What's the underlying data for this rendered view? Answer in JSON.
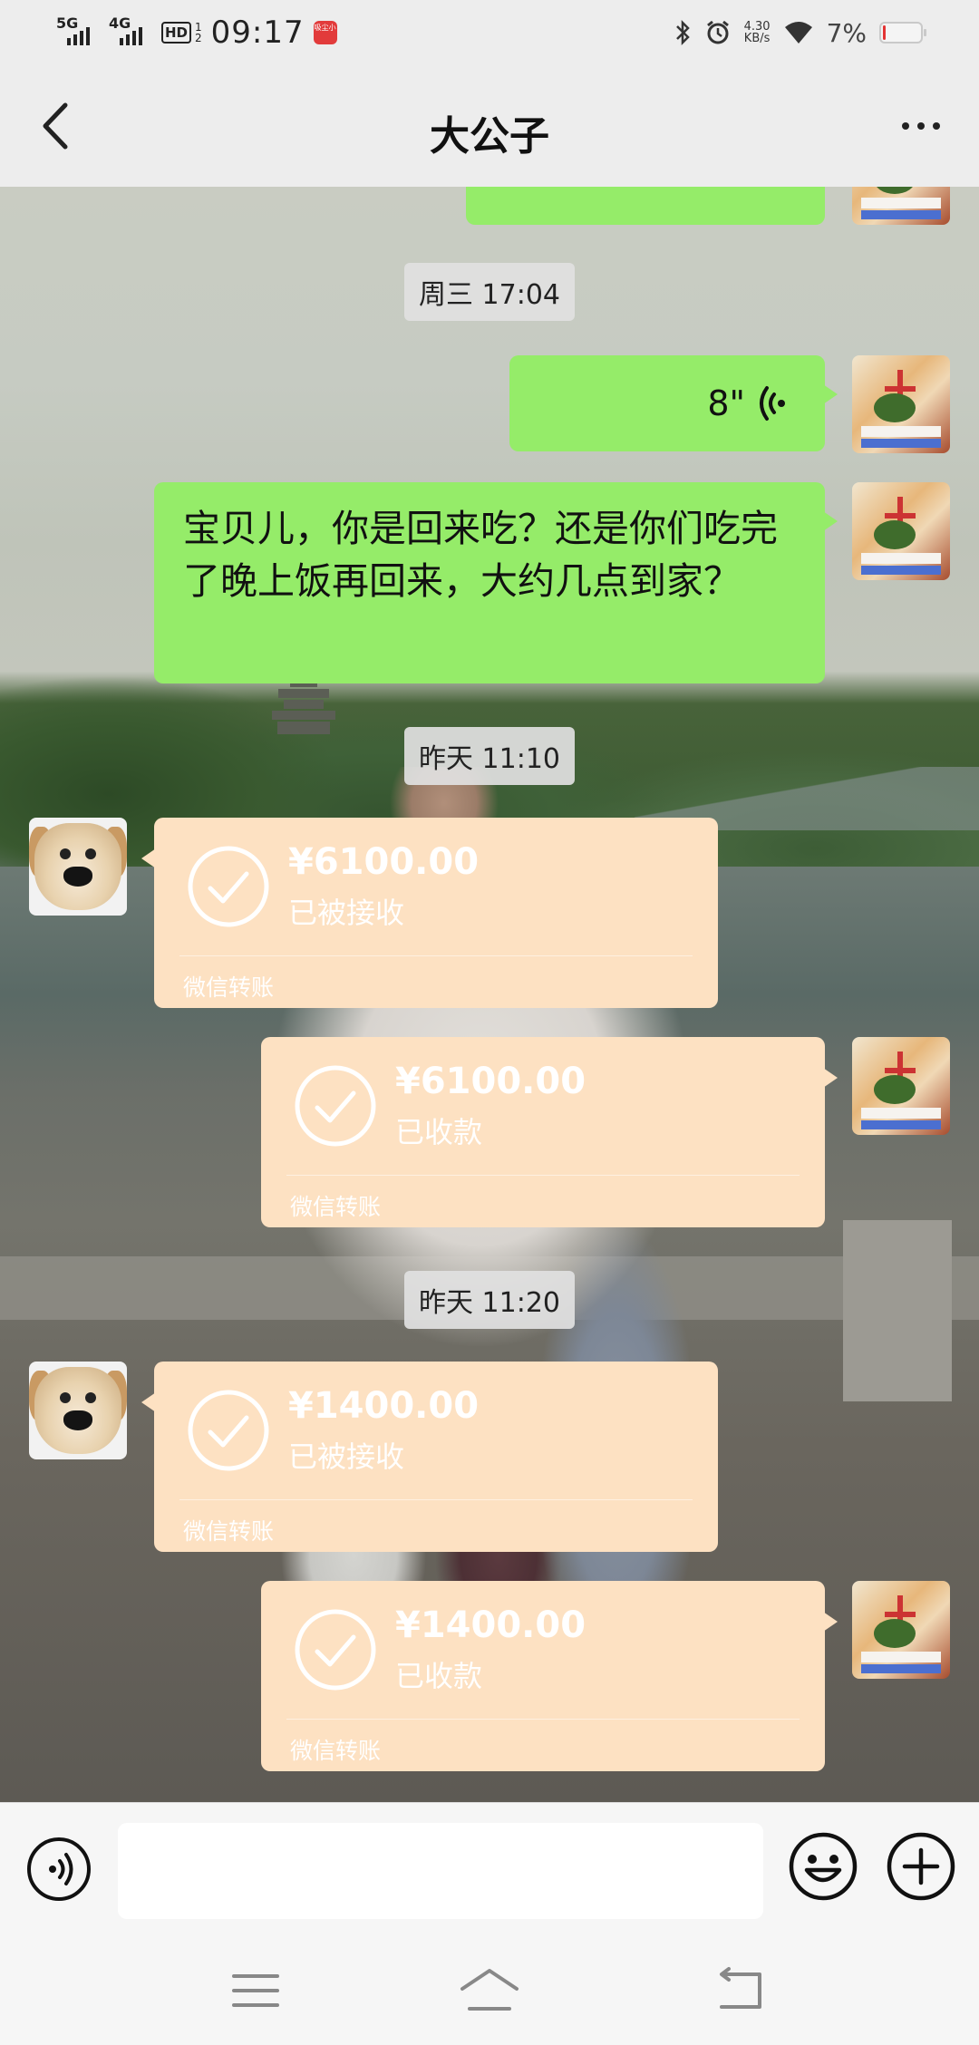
{
  "status_bar": {
    "net1": "5G",
    "net2": "4G",
    "hd": "HD",
    "hd_sub1": "1",
    "hd_sub2": "2",
    "time": "09:17",
    "app_badge": "吸尘小",
    "speed_value": "4.30",
    "speed_unit": "KB/s",
    "battery_percent": "7%",
    "battery_level": 0.07,
    "battery_color": "#e33333"
  },
  "header": {
    "back_icon": "chevron-left-icon",
    "title": "大公子",
    "more_icon": "more-dots-icon"
  },
  "chat": {
    "timestamp1": "周三 17:04",
    "voice_message": {
      "duration": "8\"",
      "icon": "voice-wave-icon"
    },
    "text_message": "宝贝儿，你是回来吃？还是你们吃完了晚上饭再回来，大约几点到家？",
    "timestamp2": "昨天 11:10",
    "timestamp3": "昨天 11:20",
    "transfers": [
      {
        "amount": "¥6100.00",
        "status": "已被接收",
        "footer": "微信转账",
        "sender": "other"
      },
      {
        "amount": "¥6100.00",
        "status": "已收款",
        "footer": "微信转账",
        "sender": "me"
      },
      {
        "amount": "¥1400.00",
        "status": "已被接收",
        "footer": "微信转账",
        "sender": "other"
      },
      {
        "amount": "¥1400.00",
        "status": "已收款",
        "footer": "微信转账",
        "sender": "me"
      }
    ]
  },
  "input_bar": {
    "placeholder": "",
    "voice_icon": "voice-input-icon",
    "emoji_icon": "emoji-icon",
    "plus_icon": "plus-icon"
  },
  "nav": {
    "menu_icon": "menu-icon",
    "home_icon": "home-icon",
    "back_icon": "back-icon"
  },
  "colors": {
    "bubble_green": "#95ec69",
    "transfer_bg": "#fde1c2",
    "chrome_bg": "#ededed"
  }
}
